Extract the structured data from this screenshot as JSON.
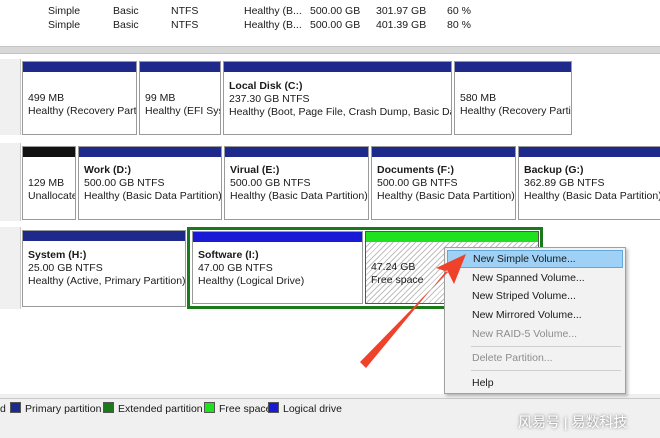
{
  "volume_rows": [
    {
      "layout": "Simple",
      "type": "Basic",
      "fs": "NTFS",
      "status": "Healthy (B...",
      "capacity": "500.00 GB",
      "free": "301.97 GB",
      "pct": "60 %"
    },
    {
      "layout": "Simple",
      "type": "Basic",
      "fs": "NTFS",
      "status": "Healthy (B...",
      "capacity": "500.00 GB",
      "free": "401.39 GB",
      "pct": "80 %"
    }
  ],
  "disk0": {
    "partitions": [
      {
        "name": "",
        "line1": "499 MB",
        "line2": "Healthy (Recovery Partition)"
      },
      {
        "name": "",
        "line1": "99 MB",
        "line2": "Healthy (EFI System Partition)"
      },
      {
        "name": "Local Disk  (C:)",
        "line1": "237.30 GB NTFS",
        "line2": "Healthy (Boot, Page File, Crash Dump, Basic Data Partition)"
      },
      {
        "name": "",
        "line1": "580 MB",
        "line2": "Healthy (Recovery Partition)"
      }
    ]
  },
  "disk1": {
    "partitions": [
      {
        "name": "",
        "line1": "129 MB",
        "line2": "Unallocated"
      },
      {
        "name": "Work  (D:)",
        "line1": "500.00 GB NTFS",
        "line2": "Healthy (Basic Data Partition)"
      },
      {
        "name": "Virual  (E:)",
        "line1": "500.00 GB NTFS",
        "line2": "Healthy (Basic Data Partition)"
      },
      {
        "name": "Documents  (F:)",
        "line1": "500.00 GB NTFS",
        "line2": "Healthy (Basic Data Partition)"
      },
      {
        "name": "Backup  (G:)",
        "line1": "362.89 GB NTFS",
        "line2": "Healthy (Basic Data Partition)"
      }
    ]
  },
  "disk2": {
    "partitions": [
      {
        "name": "System  (H:)",
        "line1": "25.00 GB NTFS",
        "line2": "Healthy (Active, Primary Partition)"
      },
      {
        "name": "Software  (I:)",
        "line1": "47.00 GB NTFS",
        "line2": "Healthy (Logical Drive)"
      },
      {
        "name": "",
        "line1": "47.24 GB",
        "line2": "Free space"
      }
    ]
  },
  "context_menu": {
    "items": [
      {
        "label": "New Simple Volume...",
        "enabled": true,
        "selected": true
      },
      {
        "label": "New Spanned Volume...",
        "enabled": true
      },
      {
        "label": "New Striped Volume...",
        "enabled": true
      },
      {
        "label": "New Mirrored Volume...",
        "enabled": true
      },
      {
        "label": "New RAID-5 Volume...",
        "enabled": false
      },
      {
        "label": "Delete Partition...",
        "enabled": false
      },
      {
        "label": "Help",
        "enabled": true
      }
    ]
  },
  "legend": {
    "items": [
      {
        "label": "d",
        "color": "#000000"
      },
      {
        "label": "Primary partition",
        "color": "#1d2a8c"
      },
      {
        "label": "Extended partition",
        "color": "#1a7a1a"
      },
      {
        "label": "Free space",
        "color": "#1fe21f"
      },
      {
        "label": "Logical drive",
        "color": "#1a1ad6"
      }
    ]
  },
  "watermark": "风易号 | 易数科技",
  "colors": {
    "primary": "#1d2a8c",
    "logical": "#1a1ad6",
    "free": "#1fe21f",
    "extended": "#1a7a1a",
    "highlight": "#9fd0f5",
    "arrow": "#f0412b"
  }
}
